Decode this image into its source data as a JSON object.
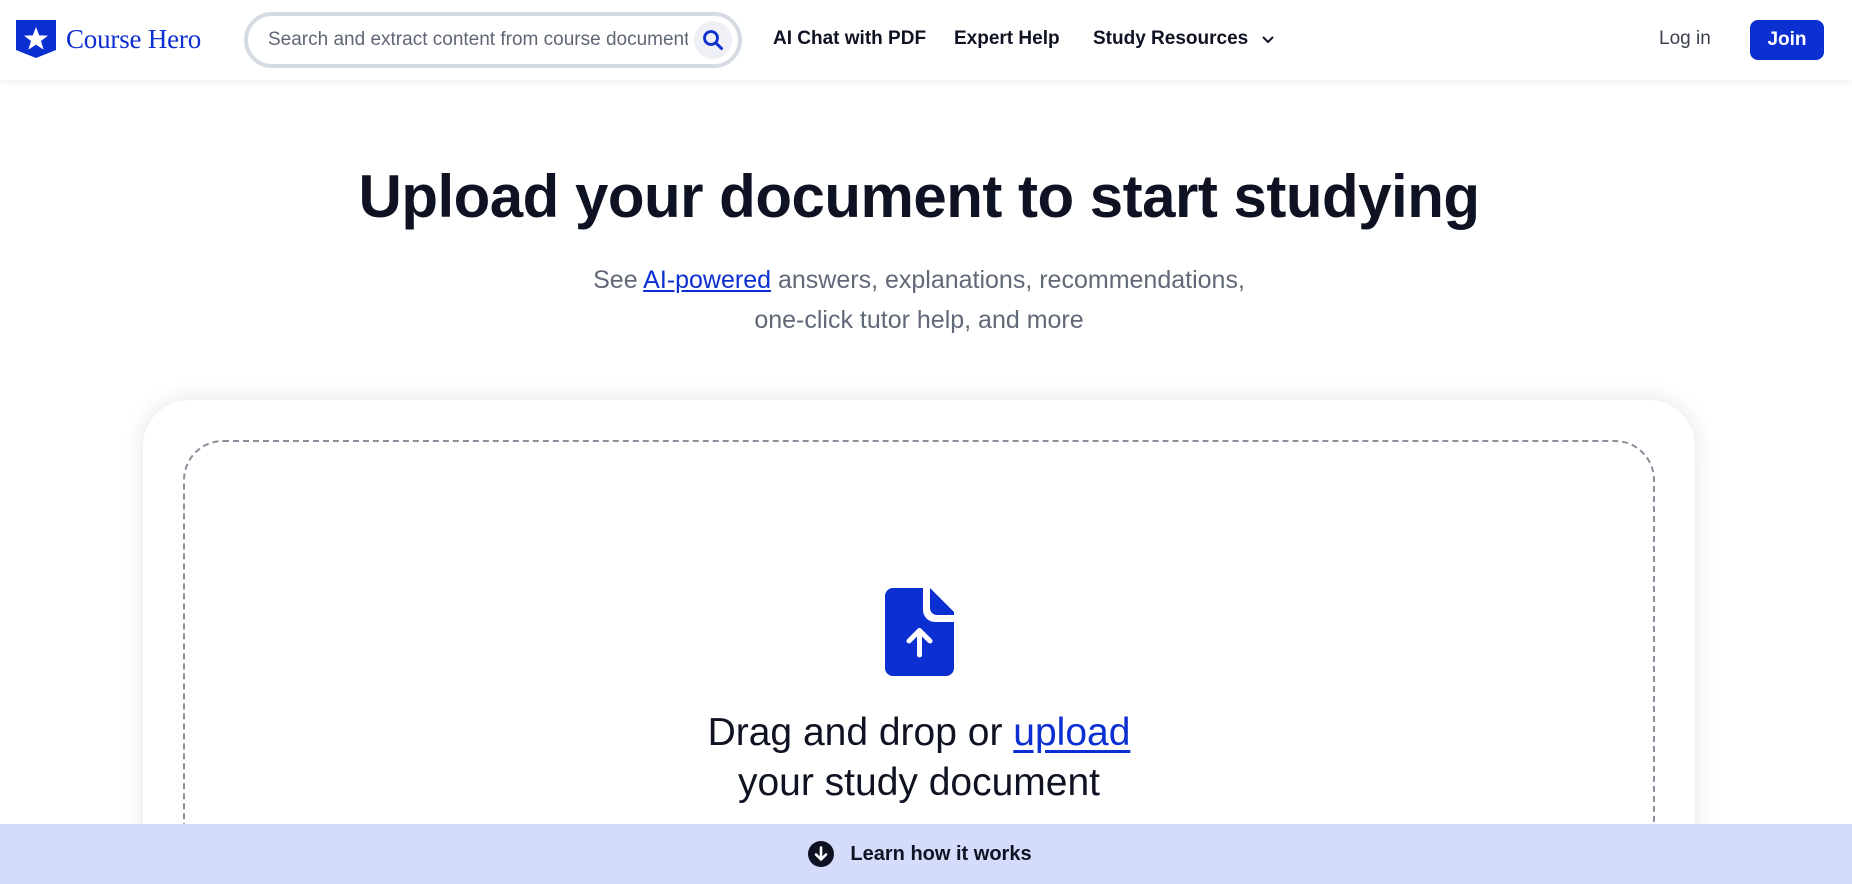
{
  "header": {
    "brand": "Course Hero",
    "search": {
      "placeholder": "Search and extract content from course documents, study guides and more",
      "value": ""
    },
    "nav": {
      "ai_chat": "AI Chat with PDF",
      "expert_help": "Expert Help",
      "study_resources": "Study Resources"
    },
    "login_label": "Log in",
    "join_label": "Join"
  },
  "hero": {
    "title": "Upload your document to start studying",
    "subtitle_pre": "See ",
    "subtitle_link": "AI-powered",
    "subtitle_post": " answers, explanations, recommendations,",
    "subtitle_line2": "one-click tutor help, and more"
  },
  "upload": {
    "text_pre": "Drag and drop or ",
    "text_link": "upload",
    "text_line2": "your study document"
  },
  "bottom_bar": {
    "label": "Learn how it works"
  },
  "colors": {
    "brand": "#0c2fd1",
    "bottom_bar_bg": "#d5dcfb",
    "muted_text": "#616878"
  },
  "icons": {
    "logo": "star-shield-icon",
    "search": "search-icon",
    "dropdown": "chevron-down-icon",
    "upload": "document-upload-icon",
    "learn": "arrow-down-circle-icon"
  }
}
